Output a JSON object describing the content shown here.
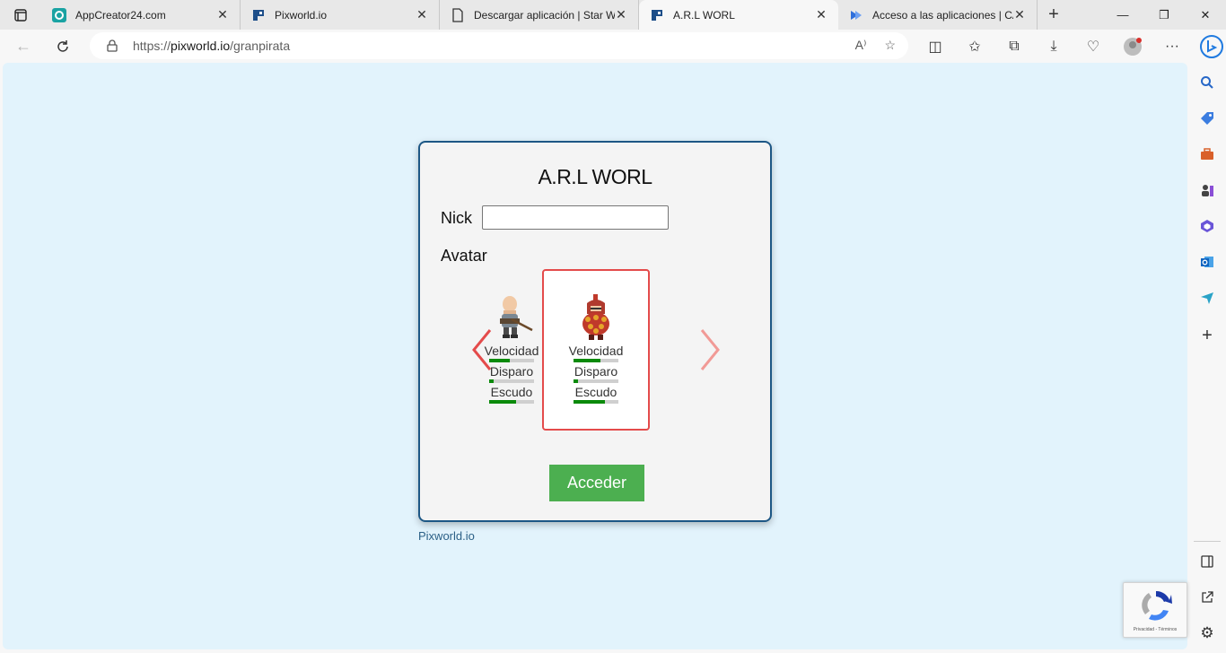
{
  "tabs": [
    {
      "title": "AppCreator24.com",
      "active": false
    },
    {
      "title": "Pixworld.io",
      "active": false
    },
    {
      "title": "Descargar aplicación | Star W",
      "active": false
    },
    {
      "title": "A.R.L WORL",
      "active": true
    },
    {
      "title": "Acceso a las aplicaciones | CA",
      "active": false
    }
  ],
  "address": {
    "prefix": "https://",
    "host": "pixworld.io",
    "path": "/granpirata"
  },
  "page": {
    "title": "A.R.L WORL",
    "nick_label": "Nick",
    "nick_value": "",
    "avatar_label": "Avatar",
    "avatars": [
      {
        "name": "bald-warrior",
        "selected": false,
        "stats": [
          {
            "label": "Velocidad",
            "value": 0.45
          },
          {
            "label": "Disparo",
            "value": 0.1
          },
          {
            "label": "Escudo",
            "value": 0.6
          }
        ]
      },
      {
        "name": "red-knight",
        "selected": true,
        "stats": [
          {
            "label": "Velocidad",
            "value": 0.6
          },
          {
            "label": "Disparo",
            "value": 0.1
          },
          {
            "label": "Escudo",
            "value": 0.7
          }
        ]
      }
    ],
    "submit_label": "Acceder",
    "footer_link": "Pixworld.io"
  },
  "recaptcha": {
    "text": "Privacidad - Términos"
  },
  "colors": {
    "accent": "#4caf50",
    "card_border": "#1d5785",
    "selected_border": "#e44b4b",
    "stat_fill": "#0a8a0a",
    "viewport_bg": "#e2f3fc"
  }
}
